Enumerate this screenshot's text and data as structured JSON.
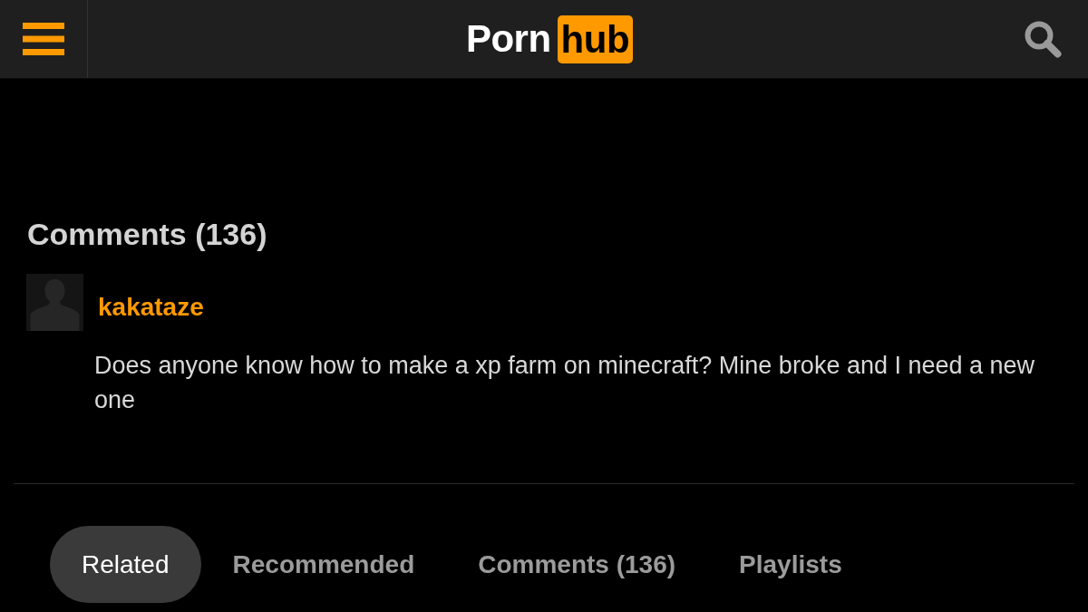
{
  "header": {
    "logo": {
      "text": "Porn",
      "highlight": "hub"
    }
  },
  "comments_section": {
    "title": "Comments (136)",
    "comments": [
      {
        "username": "kakataze",
        "text": "Does anyone know how to make a xp farm on minecraft? Mine broke and I need a new one"
      }
    ]
  },
  "tabs": [
    {
      "label": "Related",
      "selected": true
    },
    {
      "label": "Recommended",
      "selected": false
    },
    {
      "label": "Comments (136)",
      "selected": false
    },
    {
      "label": "Playlists",
      "selected": false
    }
  ]
}
